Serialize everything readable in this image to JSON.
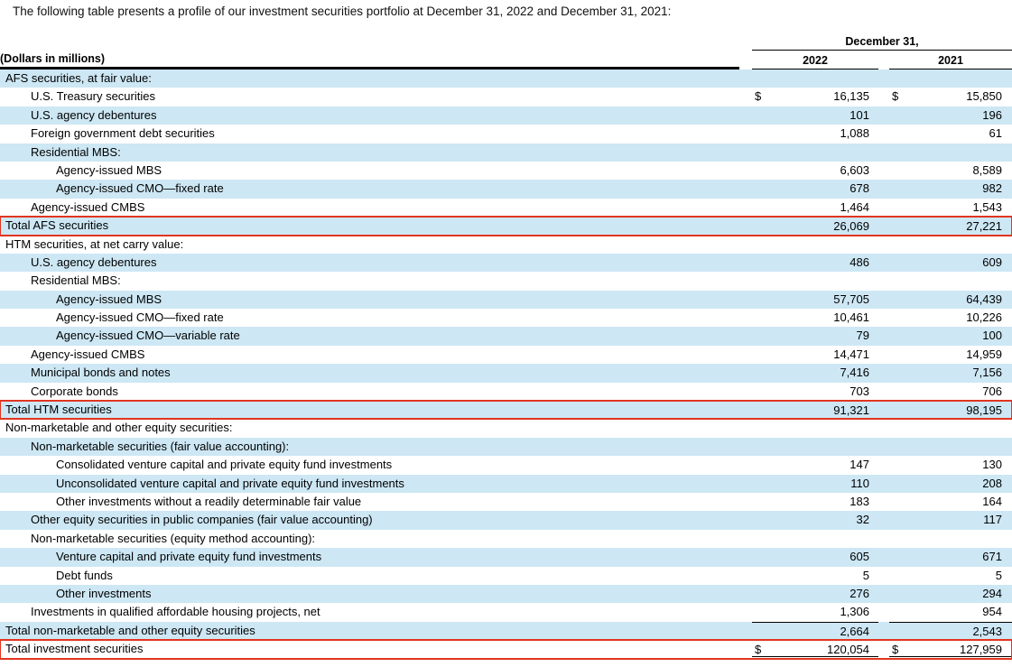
{
  "intro": "The following table presents a profile of our investment securities portfolio at December 31, 2022 and December 31, 2021:",
  "colors": {
    "row_shade": "#cde7f4",
    "highlight_border": "#e2351f",
    "rule": "#000000"
  },
  "table": {
    "header": {
      "date_label": "December 31,",
      "col_2022": "2022",
      "col_2021": "2021",
      "units_label": "(Dollars in millions)"
    },
    "rows": [
      {
        "label": "AFS securities, at fair value:",
        "indent": 0,
        "v2022": "",
        "v2021": "",
        "dollar": false
      },
      {
        "label": "U.S. Treasury securities",
        "indent": 1,
        "v2022": "16,135",
        "v2021": "15,850",
        "dollar": true
      },
      {
        "label": "U.S. agency debentures",
        "indent": 1,
        "v2022": "101",
        "v2021": "196",
        "dollar": false
      },
      {
        "label": "Foreign government debt securities",
        "indent": 1,
        "v2022": "1,088",
        "v2021": "61",
        "dollar": false
      },
      {
        "label": "Residential MBS:",
        "indent": 1,
        "v2022": "",
        "v2021": "",
        "dollar": false
      },
      {
        "label": "Agency-issued MBS",
        "indent": 2,
        "v2022": "6,603",
        "v2021": "8,589",
        "dollar": false
      },
      {
        "label": "Agency-issued CMO—fixed rate",
        "indent": 2,
        "v2022": "678",
        "v2021": "982",
        "dollar": false
      },
      {
        "label": "Agency-issued CMBS",
        "indent": 1,
        "v2022": "1,464",
        "v2021": "1,543",
        "dollar": false
      },
      {
        "label": "Total AFS securities",
        "indent": 0,
        "v2022": "26,069",
        "v2021": "27,221",
        "dollar": false,
        "total": true,
        "red_box": true
      },
      {
        "label": "HTM securities, at net carry value:",
        "indent": 0,
        "v2022": "",
        "v2021": "",
        "dollar": false
      },
      {
        "label": "U.S. agency debentures",
        "indent": 1,
        "v2022": "486",
        "v2021": "609",
        "dollar": false
      },
      {
        "label": "Residential MBS:",
        "indent": 1,
        "v2022": "",
        "v2021": "",
        "dollar": false
      },
      {
        "label": "Agency-issued MBS",
        "indent": 2,
        "v2022": "57,705",
        "v2021": "64,439",
        "dollar": false
      },
      {
        "label": "Agency-issued CMO—fixed rate",
        "indent": 2,
        "v2022": "10,461",
        "v2021": "10,226",
        "dollar": false
      },
      {
        "label": "Agency-issued CMO—variable rate",
        "indent": 2,
        "v2022": "79",
        "v2021": "100",
        "dollar": false
      },
      {
        "label": "Agency-issued CMBS",
        "indent": 1,
        "v2022": "14,471",
        "v2021": "14,959",
        "dollar": false
      },
      {
        "label": "Municipal bonds and notes",
        "indent": 1,
        "v2022": "7,416",
        "v2021": "7,156",
        "dollar": false
      },
      {
        "label": "Corporate bonds",
        "indent": 1,
        "v2022": "703",
        "v2021": "706",
        "dollar": false
      },
      {
        "label": "Total HTM securities",
        "indent": 0,
        "v2022": "91,321",
        "v2021": "98,195",
        "dollar": false,
        "total": true,
        "red_box": true
      },
      {
        "label": "Non-marketable and other equity securities:",
        "indent": 0,
        "v2022": "",
        "v2021": "",
        "dollar": false
      },
      {
        "label": "Non-marketable securities (fair value accounting):",
        "indent": 1,
        "v2022": "",
        "v2021": "",
        "dollar": false
      },
      {
        "label": "Consolidated venture capital and private equity fund investments",
        "indent": 2,
        "v2022": "147",
        "v2021": "130",
        "dollar": false
      },
      {
        "label": "Unconsolidated venture capital and private equity fund investments",
        "indent": 2,
        "v2022": "110",
        "v2021": "208",
        "dollar": false
      },
      {
        "label": "Other investments without a readily determinable fair value",
        "indent": 2,
        "v2022": "183",
        "v2021": "164",
        "dollar": false
      },
      {
        "label": "Other equity securities in public companies (fair value accounting)",
        "indent": 1,
        "v2022": "32",
        "v2021": "117",
        "dollar": false
      },
      {
        "label": "Non-marketable securities (equity method accounting):",
        "indent": 1,
        "v2022": "",
        "v2021": "",
        "dollar": false
      },
      {
        "label": "Venture capital and private equity fund investments",
        "indent": 2,
        "v2022": "605",
        "v2021": "671",
        "dollar": false
      },
      {
        "label": "Debt funds",
        "indent": 2,
        "v2022": "5",
        "v2021": "5",
        "dollar": false
      },
      {
        "label": "Other investments",
        "indent": 2,
        "v2022": "276",
        "v2021": "294",
        "dollar": false
      },
      {
        "label": "Investments in qualified affordable housing projects, net",
        "indent": 1,
        "v2022": "1,306",
        "v2021": "954",
        "dollar": false
      },
      {
        "label": "Total non-marketable and other equity securities",
        "indent": 0,
        "v2022": "2,664",
        "v2021": "2,543",
        "dollar": false,
        "total": true
      },
      {
        "label": "Total investment securities",
        "indent": 0,
        "v2022": "120,054",
        "v2021": "127,959",
        "dollar": true,
        "total": true,
        "red_box": true,
        "dbl": true
      }
    ]
  }
}
